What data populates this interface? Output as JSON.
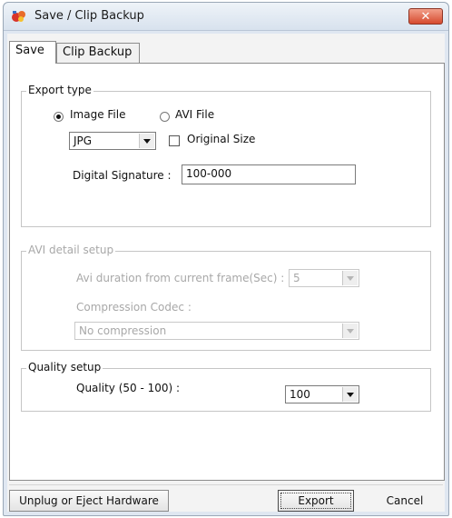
{
  "window": {
    "title": "Save / Clip Backup",
    "close_label": "✕"
  },
  "tabs": [
    {
      "label": "Save",
      "active": true
    },
    {
      "label": "Clip Backup",
      "active": false
    }
  ],
  "export_type": {
    "group_label": "Export type",
    "radio_image": "Image File",
    "radio_avi": "AVI File",
    "format_value": "JPG",
    "original_size_label": "Original Size",
    "signature_label": "Digital Signature :",
    "signature_value": "100-000"
  },
  "avi_setup": {
    "group_label": "AVI detail setup",
    "duration_label": "Avi duration from current frame(Sec) :",
    "duration_value": "5",
    "codec_label": "Compression Codec :",
    "codec_value": "No compression"
  },
  "quality": {
    "group_label": "Quality setup",
    "quality_label": "Quality (50 - 100) :",
    "quality_value": "100"
  },
  "buttons": {
    "unplug": "Unplug or Eject Hardware",
    "export": "Export",
    "cancel": "Cancel"
  },
  "colors": {
    "close_button": "#d64a2e",
    "title_bar": "#dfe7f1"
  }
}
